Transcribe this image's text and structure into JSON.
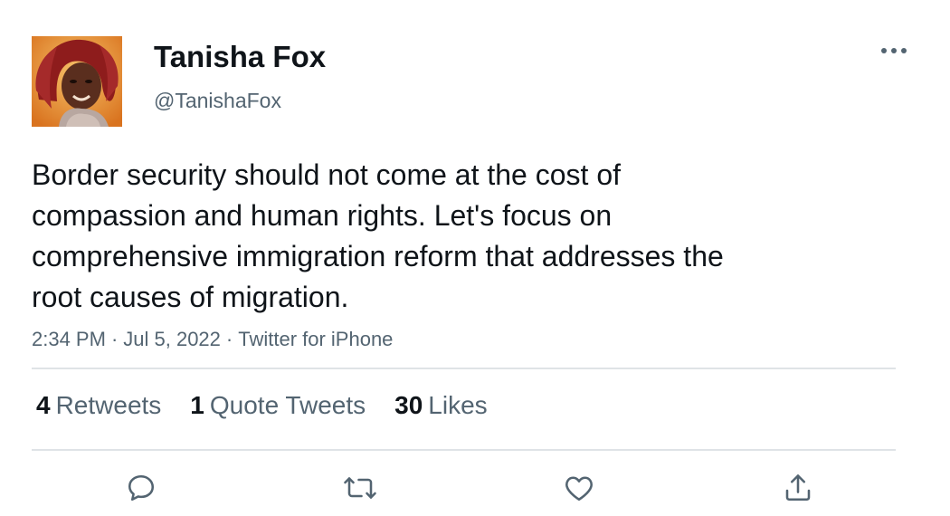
{
  "author": {
    "display_name": "Tanisha Fox",
    "handle": "@TanishaFox",
    "avatar_icon": "profile-photo"
  },
  "tweet": {
    "text_lines": [
      "Border security should not come at the cost of",
      "compassion and human rights. Let's focus on",
      "comprehensive immigration reform that addresses the",
      "root causes of migration."
    ],
    "time": "2:34 PM",
    "date": "Jul 5, 2022",
    "source": "Twitter for iPhone",
    "separator": "·"
  },
  "stats": {
    "retweets": {
      "count": "4",
      "label": "Retweets"
    },
    "quotes": {
      "count": "1",
      "label": "Quote Tweets"
    },
    "likes": {
      "count": "30",
      "label": "Likes"
    }
  },
  "actions": {
    "reply_icon": "reply-icon",
    "retweet_icon": "retweet-icon",
    "like_icon": "heart-icon",
    "share_icon": "share-icon",
    "more_icon": "more-icon"
  },
  "colors": {
    "text_primary": "#0f1419",
    "text_secondary": "#536471",
    "divider": "#dfe3e6",
    "background": "#ffffff"
  }
}
